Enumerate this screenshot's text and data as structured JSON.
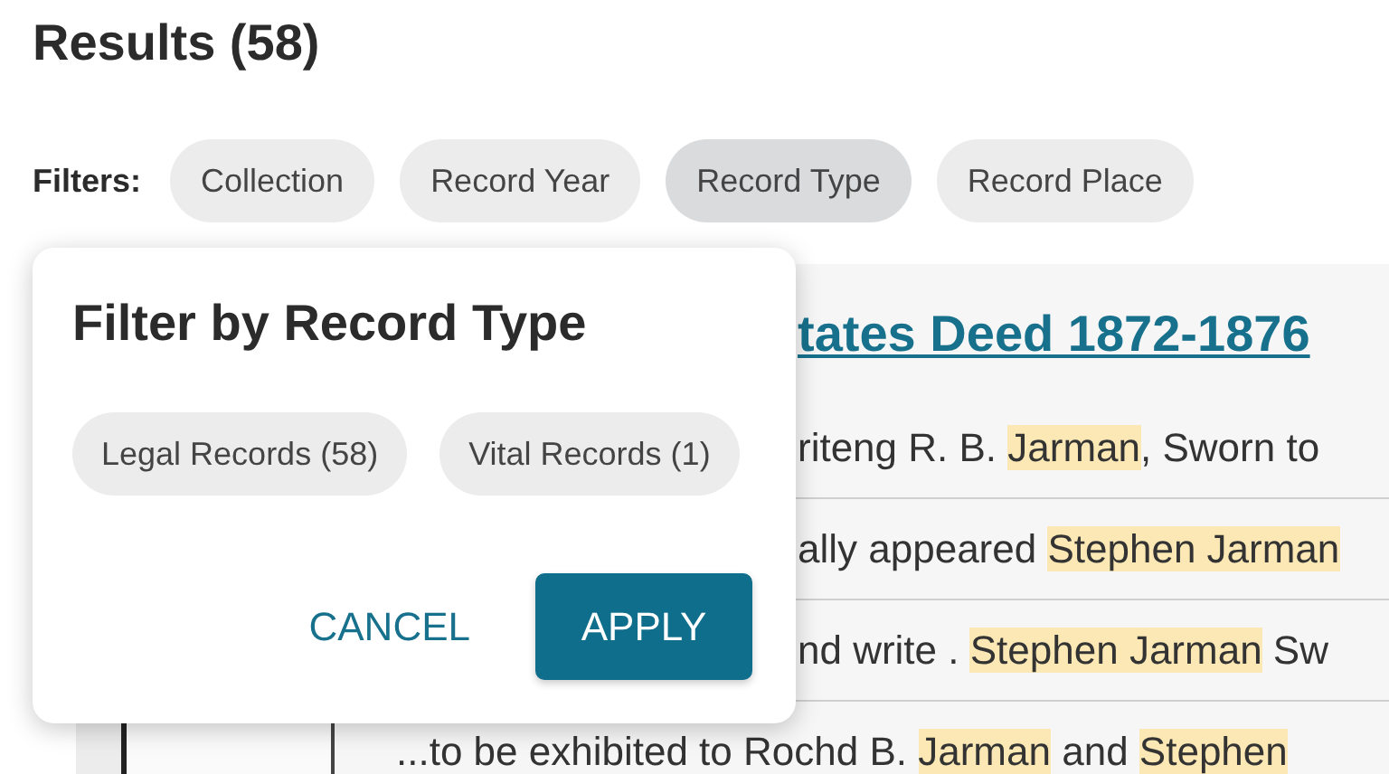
{
  "heading": "Results (58)",
  "filters": {
    "label": "Filters:",
    "chips": [
      {
        "label": "Collection",
        "selected": false
      },
      {
        "label": "Record Year",
        "selected": false
      },
      {
        "label": "Record Type",
        "selected": true
      },
      {
        "label": "Record Place",
        "selected": false
      }
    ]
  },
  "result": {
    "title": "tates Deed 1872-1876",
    "snippets": [
      [
        {
          "text": "riteng R. B. ",
          "highlighted": false
        },
        {
          "text": "Jarman",
          "highlighted": true
        },
        {
          "text": ", Sworn to",
          "highlighted": false
        }
      ],
      [
        {
          "text": "ally appeared ",
          "highlighted": false
        },
        {
          "text": "Stephen Jarman",
          "highlighted": true
        }
      ],
      [
        {
          "text": "nd write . ",
          "highlighted": false
        },
        {
          "text": "Stephen Jarman",
          "highlighted": true
        },
        {
          "text": " Sw",
          "highlighted": false
        }
      ],
      [
        {
          "text": "...to be exhibited to Rochd B. ",
          "highlighted": false
        },
        {
          "text": "Jarman",
          "highlighted": true
        },
        {
          "text": " and ",
          "highlighted": false
        },
        {
          "text": "Stephen",
          "highlighted": true
        }
      ]
    ]
  },
  "popup": {
    "title": "Filter by Record Type",
    "options": [
      {
        "label": "Legal Records (58)",
        "selected": false
      },
      {
        "label": "Vital Records (1)",
        "selected": false
      }
    ],
    "cancel": "CANCEL",
    "apply": "APPLY"
  }
}
